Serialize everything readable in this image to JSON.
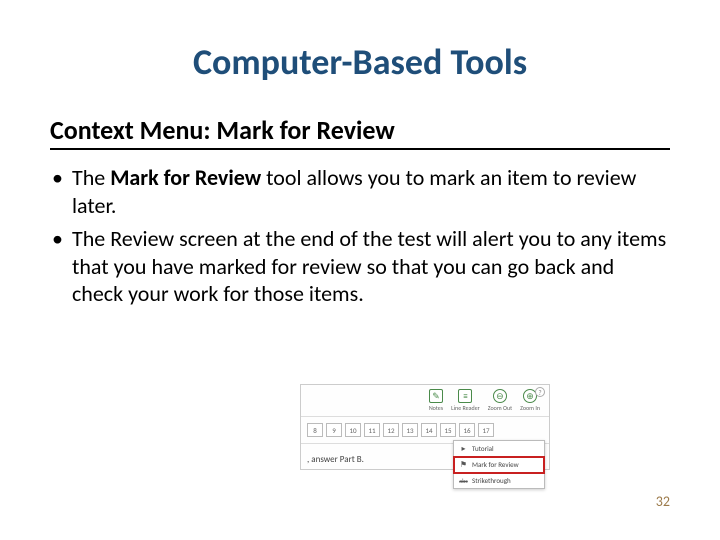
{
  "title": "Computer-Based Tools",
  "subtitle": "Context Menu: Mark for Review",
  "bullets": [
    {
      "pre": "The ",
      "bold": "Mark for Review",
      "post": " tool allows you to mark an item to review later."
    },
    {
      "pre": "The Review screen at the end of the test will alert you to any items that you have marked for review so that you can go back and check your work for those items.",
      "bold": "",
      "post": ""
    }
  ],
  "figure": {
    "toolbar": [
      {
        "icon": "✎",
        "label": "Notes"
      },
      {
        "icon": "≡",
        "label": "Line Reader"
      },
      {
        "icon": "⊖",
        "label": "Zoom Out",
        "round": true
      },
      {
        "icon": "⊕",
        "label": "Zoom In",
        "round": true
      }
    ],
    "help": "?",
    "pages": [
      "8",
      "9",
      "10",
      "11",
      "12",
      "13",
      "14",
      "15",
      "16",
      "17"
    ],
    "answer_text": ", answer Part B.",
    "menu": [
      {
        "icon": "▸",
        "label": "Tutorial"
      },
      {
        "icon": "⚑",
        "label": "Mark for Review",
        "highlight": true
      },
      {
        "icon": "abc",
        "label": "Strikethrough"
      }
    ]
  },
  "page_number": "32"
}
